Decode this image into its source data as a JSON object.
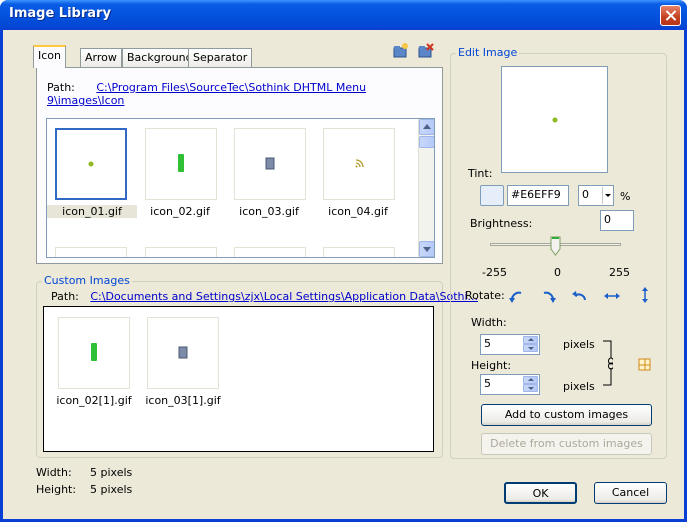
{
  "window": {
    "title": "Image Library"
  },
  "tabs": [
    {
      "label": "Icon",
      "active": true
    },
    {
      "label": "Arrow",
      "active": false
    },
    {
      "label": "Background",
      "active": false
    },
    {
      "label": "Separator",
      "active": false
    }
  ],
  "library": {
    "path_label": "Path:",
    "path_value": "C:\\Program Files\\SourceTec\\Sothink DHTML Menu 9\\images\\Icon",
    "images": [
      {
        "name": "icon_01.gif",
        "selected": true,
        "preview": "small-green-dot"
      },
      {
        "name": "icon_02.gif",
        "selected": false,
        "preview": "green-bar"
      },
      {
        "name": "icon_03.gif",
        "selected": false,
        "preview": "blue-gray-rect"
      },
      {
        "name": "icon_04.gif",
        "selected": false,
        "preview": "rss-icon"
      }
    ]
  },
  "custom": {
    "group_title": "Custom Images",
    "path_label": "Path:",
    "path_value": "C:\\Documents and Settings\\zjx\\Local Settings\\Application Data\\Sothi...",
    "images": [
      {
        "name": "icon_02[1].gif",
        "preview": "green-bar"
      },
      {
        "name": "icon_03[1].gif",
        "preview": "blue-gray-rect"
      }
    ]
  },
  "info": {
    "width_label": "Width:",
    "width_value": "5 pixels",
    "height_label": "Height:",
    "height_value": "5 pixels"
  },
  "edit": {
    "group_title": "Edit Image",
    "tint_label": "Tint:",
    "tint_hex": "#E6EFF9",
    "tint_percent": "0",
    "percent_sign": "%",
    "brightness_label": "Brightness:",
    "brightness_value": "0",
    "slider_min": "-255",
    "slider_mid": "0",
    "slider_max": "255",
    "slider_fraction": 0.5,
    "rotate_label": "Rotate:",
    "width_label": "Width:",
    "width_value": "5",
    "width_unit": "pixels",
    "height_label": "Height:",
    "height_value": "5",
    "height_unit": "pixels",
    "add_button": "Add to custom images",
    "delete_button": "Delete from custom images"
  },
  "buttons": {
    "ok": "OK",
    "cancel": "Cancel"
  },
  "colors": {
    "accent": "#316ac5",
    "group_label": "#0046d5",
    "titlebar": "#0453e0",
    "link": "#0000cc"
  }
}
